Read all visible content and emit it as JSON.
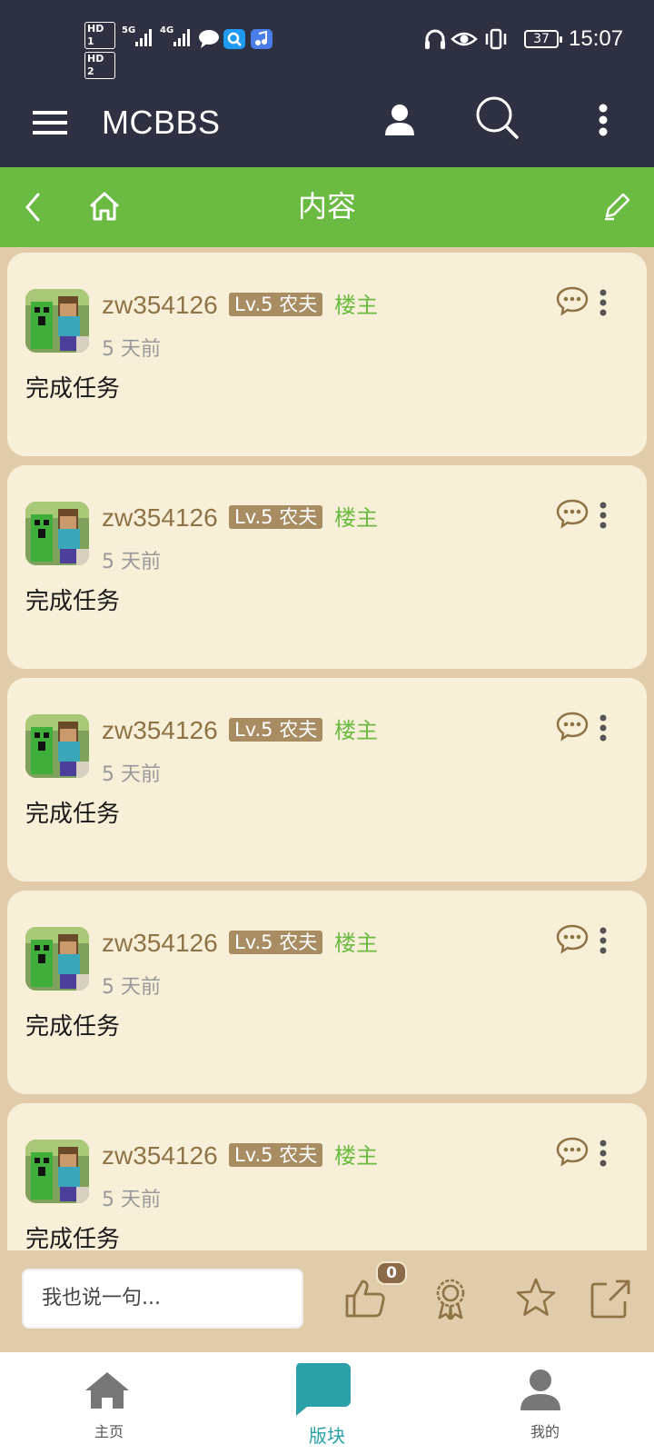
{
  "status_bar": {
    "sim1": "HD 1",
    "sim2": "HD 2",
    "net1": "5G",
    "net2": "4G",
    "battery": "37",
    "time": "15:07"
  },
  "app_bar": {
    "title": "MCBBS",
    "icons": [
      "menu-icon",
      "user-icon",
      "search-icon",
      "more-vertical-icon"
    ]
  },
  "sub_bar": {
    "title": "内容",
    "icons": [
      "back-icon",
      "home-icon",
      "edit-icon"
    ]
  },
  "posts": [
    {
      "author": "zw354126",
      "level": "Lv.5 农夫",
      "tag": "楼主",
      "time": "5 天前",
      "content": "完成任务"
    },
    {
      "author": "zw354126",
      "level": "Lv.5 农夫",
      "tag": "楼主",
      "time": "5 天前",
      "content": "完成任务"
    },
    {
      "author": "zw354126",
      "level": "Lv.5 农夫",
      "tag": "楼主",
      "time": "5 天前",
      "content": "完成任务"
    },
    {
      "author": "zw354126",
      "level": "Lv.5 农夫",
      "tag": "楼主",
      "time": "5 天前",
      "content": "完成任务"
    },
    {
      "author": "zw354126",
      "level": "Lv.5 农夫",
      "tag": "楼主",
      "time": "5 天前",
      "content": "完成任务"
    }
  ],
  "action_bar": {
    "reply_placeholder": "我也说一句...",
    "like_count": "0",
    "icons": [
      "thumbs-up-icon",
      "award-icon",
      "star-icon",
      "share-icon"
    ]
  },
  "bottom_nav": {
    "items": [
      {
        "label": "主页",
        "icon": "home-icon"
      },
      {
        "label": "版块",
        "icon": "chat-bubble-icon"
      },
      {
        "label": "我的",
        "icon": "person-icon"
      }
    ]
  },
  "colors": {
    "header": "#2d3142",
    "accent_green": "#6bbb43",
    "card": "#f8efd8",
    "page_bg": "#e0ccaa",
    "nav_active": "#2aa1a8"
  }
}
